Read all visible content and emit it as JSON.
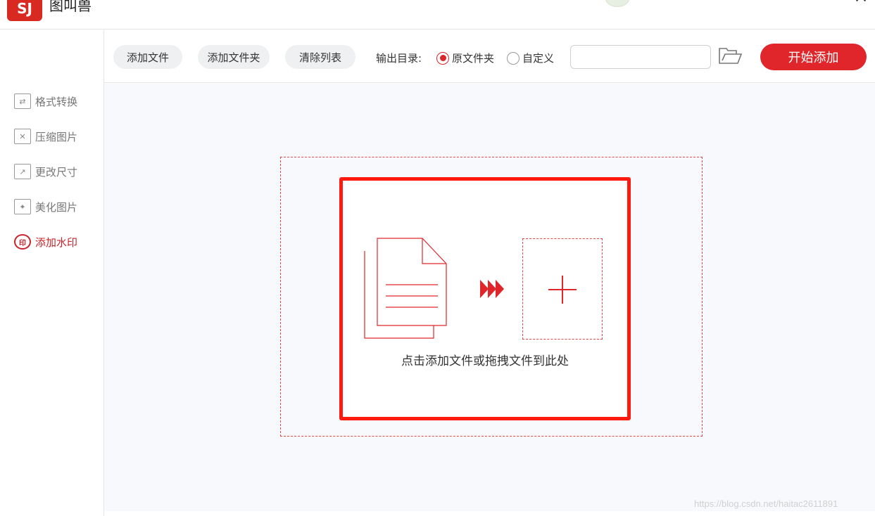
{
  "app": {
    "title": "图叫兽",
    "logo_text": "SJ"
  },
  "sidebar": {
    "items": [
      {
        "label": "格式转换",
        "icon": "convert-icon",
        "glyph": "⇄"
      },
      {
        "label": "压缩图片",
        "icon": "compress-icon",
        "glyph": "✕"
      },
      {
        "label": "更改尺寸",
        "icon": "resize-icon",
        "glyph": "↗"
      },
      {
        "label": "美化图片",
        "icon": "beautify-icon",
        "glyph": "✦"
      },
      {
        "label": "添加水印",
        "icon": "watermark-icon",
        "glyph": "印",
        "active": true
      }
    ]
  },
  "toolbar": {
    "add_file": "添加文件",
    "add_folder": "添加文件夹",
    "clear_list": "清除列表",
    "output_dir_label": "输出目录:",
    "radio_original": "原文件夹",
    "radio_custom": "自定义",
    "selected_output": "原文件夹",
    "path_value": "",
    "start_button": "开始添加"
  },
  "main": {
    "drop_hint": "点击添加文件或拖拽文件到此处"
  },
  "watermark_text": "https://blog.csdn.net/haitac2611891",
  "colors": {
    "accent": "#e0262a",
    "highlight": "#ff1a0f",
    "background": "#f7f9fc"
  }
}
